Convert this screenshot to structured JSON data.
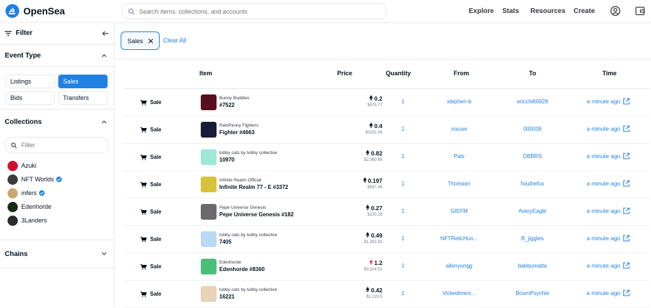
{
  "app": {
    "name": "OpenSea"
  },
  "search": {
    "placeholder": "Search items, collections, and accounts"
  },
  "nav": [
    "Explore",
    "Stats",
    "Resources",
    "Create"
  ],
  "sidebar": {
    "filter_label": "Filter",
    "event_type": {
      "title": "Event Type",
      "options": [
        "Listings",
        "Sales",
        "Bids",
        "Transfers"
      ],
      "selected": "Sales"
    },
    "collections": {
      "title": "Collections",
      "filter_placeholder": "Filter",
      "items": [
        {
          "label": "Azuki",
          "color": "#d0112b",
          "verified": false
        },
        {
          "label": "NFT Worlds",
          "color": "#3b3b3b",
          "verified": true
        },
        {
          "label": "mfers",
          "color": "#c8a96e",
          "verified": true
        },
        {
          "label": "Edenhorde",
          "color": "#1a2a1a",
          "verified": false
        },
        {
          "label": "3Landers",
          "color": "#2b2b2b",
          "verified": false
        }
      ]
    },
    "chains": {
      "title": "Chains"
    }
  },
  "filters": {
    "active_tag": "Sales",
    "clear_label": "Clear All"
  },
  "table": {
    "headers": {
      "item": "Item",
      "price": "Price",
      "quantity": "Quantity",
      "from": "From",
      "to": "To",
      "time": "Time"
    },
    "rows": [
      {
        "event": "Sale",
        "collection": "Bunny Buddies",
        "name": "#7522",
        "price": "0.2",
        "usd": "$575.77",
        "qty": "1",
        "from": "stephen-b",
        "to": "ericchi66928",
        "time": "a minute ago",
        "thumb": "#5a0f1f",
        "currency": "eth"
      },
      {
        "event": "Sale",
        "collection": "RektPenny Fighters",
        "name": "Fighter #4663",
        "price": "0.4",
        "usd": "$1151.54",
        "qty": "1",
        "from": "mxuse",
        "to": "000009",
        "time": "a minute ago",
        "thumb": "#1b1b3a",
        "currency": "eth"
      },
      {
        "event": "Sale",
        "collection": "tubby cats by tubby collective",
        "name": "10970",
        "price": "0.82",
        "usd": "$2,360.65",
        "qty": "1",
        "from": "Pals",
        "to": "DBBRS",
        "time": "a minute ago",
        "thumb": "#9ee8d8",
        "currency": "eth"
      },
      {
        "event": "Sale",
        "collection": "Infinite Realm Official",
        "name": "Infinite Realm 77 - E #3372",
        "price": "0.197",
        "usd": "$567.46",
        "qty": "1",
        "from": "Thorisian",
        "to": "fxiuthefox",
        "time": "a minute ago",
        "thumb": "#d8c23a",
        "currency": "eth"
      },
      {
        "event": "Sale",
        "collection": "Pepe Universe Genesis",
        "name": "Pepe Universe Genesis #182",
        "price": "0.27",
        "usd": "$120.28",
        "qty": "1",
        "from": "GIEFM",
        "to": "AveryEagle",
        "time": "a minute ago",
        "thumb": "#6a6a6a",
        "currency": "eth"
      },
      {
        "event": "Sale",
        "collection": "tubby cats by tubby collective",
        "name": "7405",
        "price": "0.49",
        "usd": "$1,392.83",
        "qty": "1",
        "from": "NFTRelicHun...",
        "to": "B_jiggles",
        "time": "a minute ago",
        "thumb": "#b9d9f5",
        "currency": "eth"
      },
      {
        "event": "Sale",
        "collection": "Edenhorde",
        "name": "Edenhorde #8360",
        "price": "1.2",
        "usd": "$3,214.51",
        "qty": "1",
        "from": "allenyongg",
        "to": "babbumatta",
        "time": "a minute ago",
        "thumb": "#4bbf7a",
        "currency": "weth"
      },
      {
        "event": "Sale",
        "collection": "tubby cats by tubby collective",
        "name": "16221",
        "price": "0.42",
        "usd": "$1,120.5",
        "qty": "1",
        "from": "Vickedmem...",
        "to": "BoomPsychie",
        "time": "a minute ago",
        "thumb": "#e8d2b8",
        "currency": "eth"
      }
    ]
  },
  "colors": {
    "accent": "#2081e2",
    "weth": "#e5404f",
    "text": "#04111d"
  }
}
